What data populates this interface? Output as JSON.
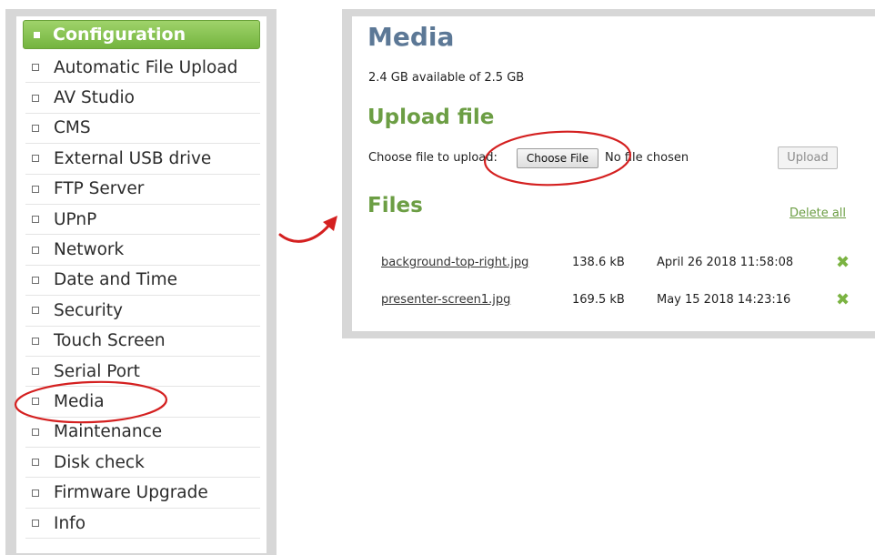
{
  "sidebar": {
    "header": "Configuration",
    "items": [
      {
        "label": "Automatic File Upload"
      },
      {
        "label": "AV Studio"
      },
      {
        "label": "CMS"
      },
      {
        "label": "External USB drive"
      },
      {
        "label": "FTP Server"
      },
      {
        "label": "UPnP"
      },
      {
        "label": "Network"
      },
      {
        "label": "Date and Time"
      },
      {
        "label": "Security"
      },
      {
        "label": "Touch Screen"
      },
      {
        "label": "Serial Port"
      },
      {
        "label": "Media"
      },
      {
        "label": "Maintenance"
      },
      {
        "label": "Disk check"
      },
      {
        "label": "Firmware Upgrade"
      },
      {
        "label": "Info"
      }
    ]
  },
  "media": {
    "title": "Media",
    "available": "2.4 GB available of 2.5 GB",
    "upload_heading": "Upload file",
    "choose_label": "Choose file to upload:",
    "choose_button": "Choose File",
    "no_file": "No file chosen",
    "upload_button": "Upload",
    "files_heading": "Files",
    "delete_all": "Delete all",
    "files": [
      {
        "name": "background-top-right.jpg",
        "size": "138.6 kB",
        "date": "April 26 2018 11:58:08"
      },
      {
        "name": "presenter-screen1.jpg",
        "size": "169.5 kB",
        "date": "May 15 2018 14:23:16"
      }
    ]
  },
  "colors": {
    "accent_green": "#6c9e44",
    "title_blue": "#5c7896",
    "annotation_red": "#d42020"
  },
  "icons": {
    "delete": "x-icon",
    "menu_bullet": "square-bullet-icon"
  }
}
